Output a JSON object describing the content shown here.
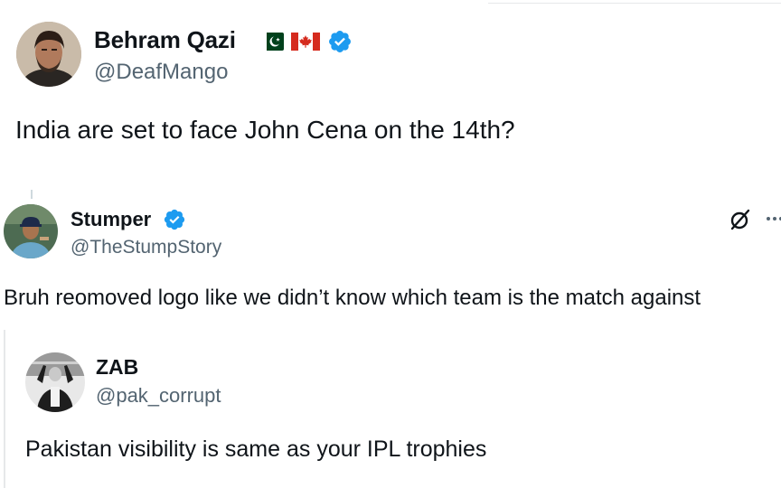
{
  "post1": {
    "author_name": "Behram Qazi",
    "handle": "@DeafMango",
    "text": "India are set to face John Cena on the 14th?",
    "badges": [
      "pakistan-flag-icon",
      "canada-flag-icon",
      "verified-badge-icon"
    ]
  },
  "post2": {
    "author_name": "Stumper",
    "handle": "@TheStumpStory",
    "text": "Bruh reomoved logo like we didn’t know which team is the match against",
    "badges": [
      "verified-badge-icon"
    ],
    "actions": [
      "grok-icon",
      "more-icon"
    ]
  },
  "post3": {
    "author_name": "ZAB",
    "handle": "@pak_corrupt",
    "text": "Pakistan visibility is same as your IPL trophies"
  },
  "colors": {
    "text": "#0f1419",
    "secondary": "#536471",
    "verified": "#1d9bf0"
  }
}
